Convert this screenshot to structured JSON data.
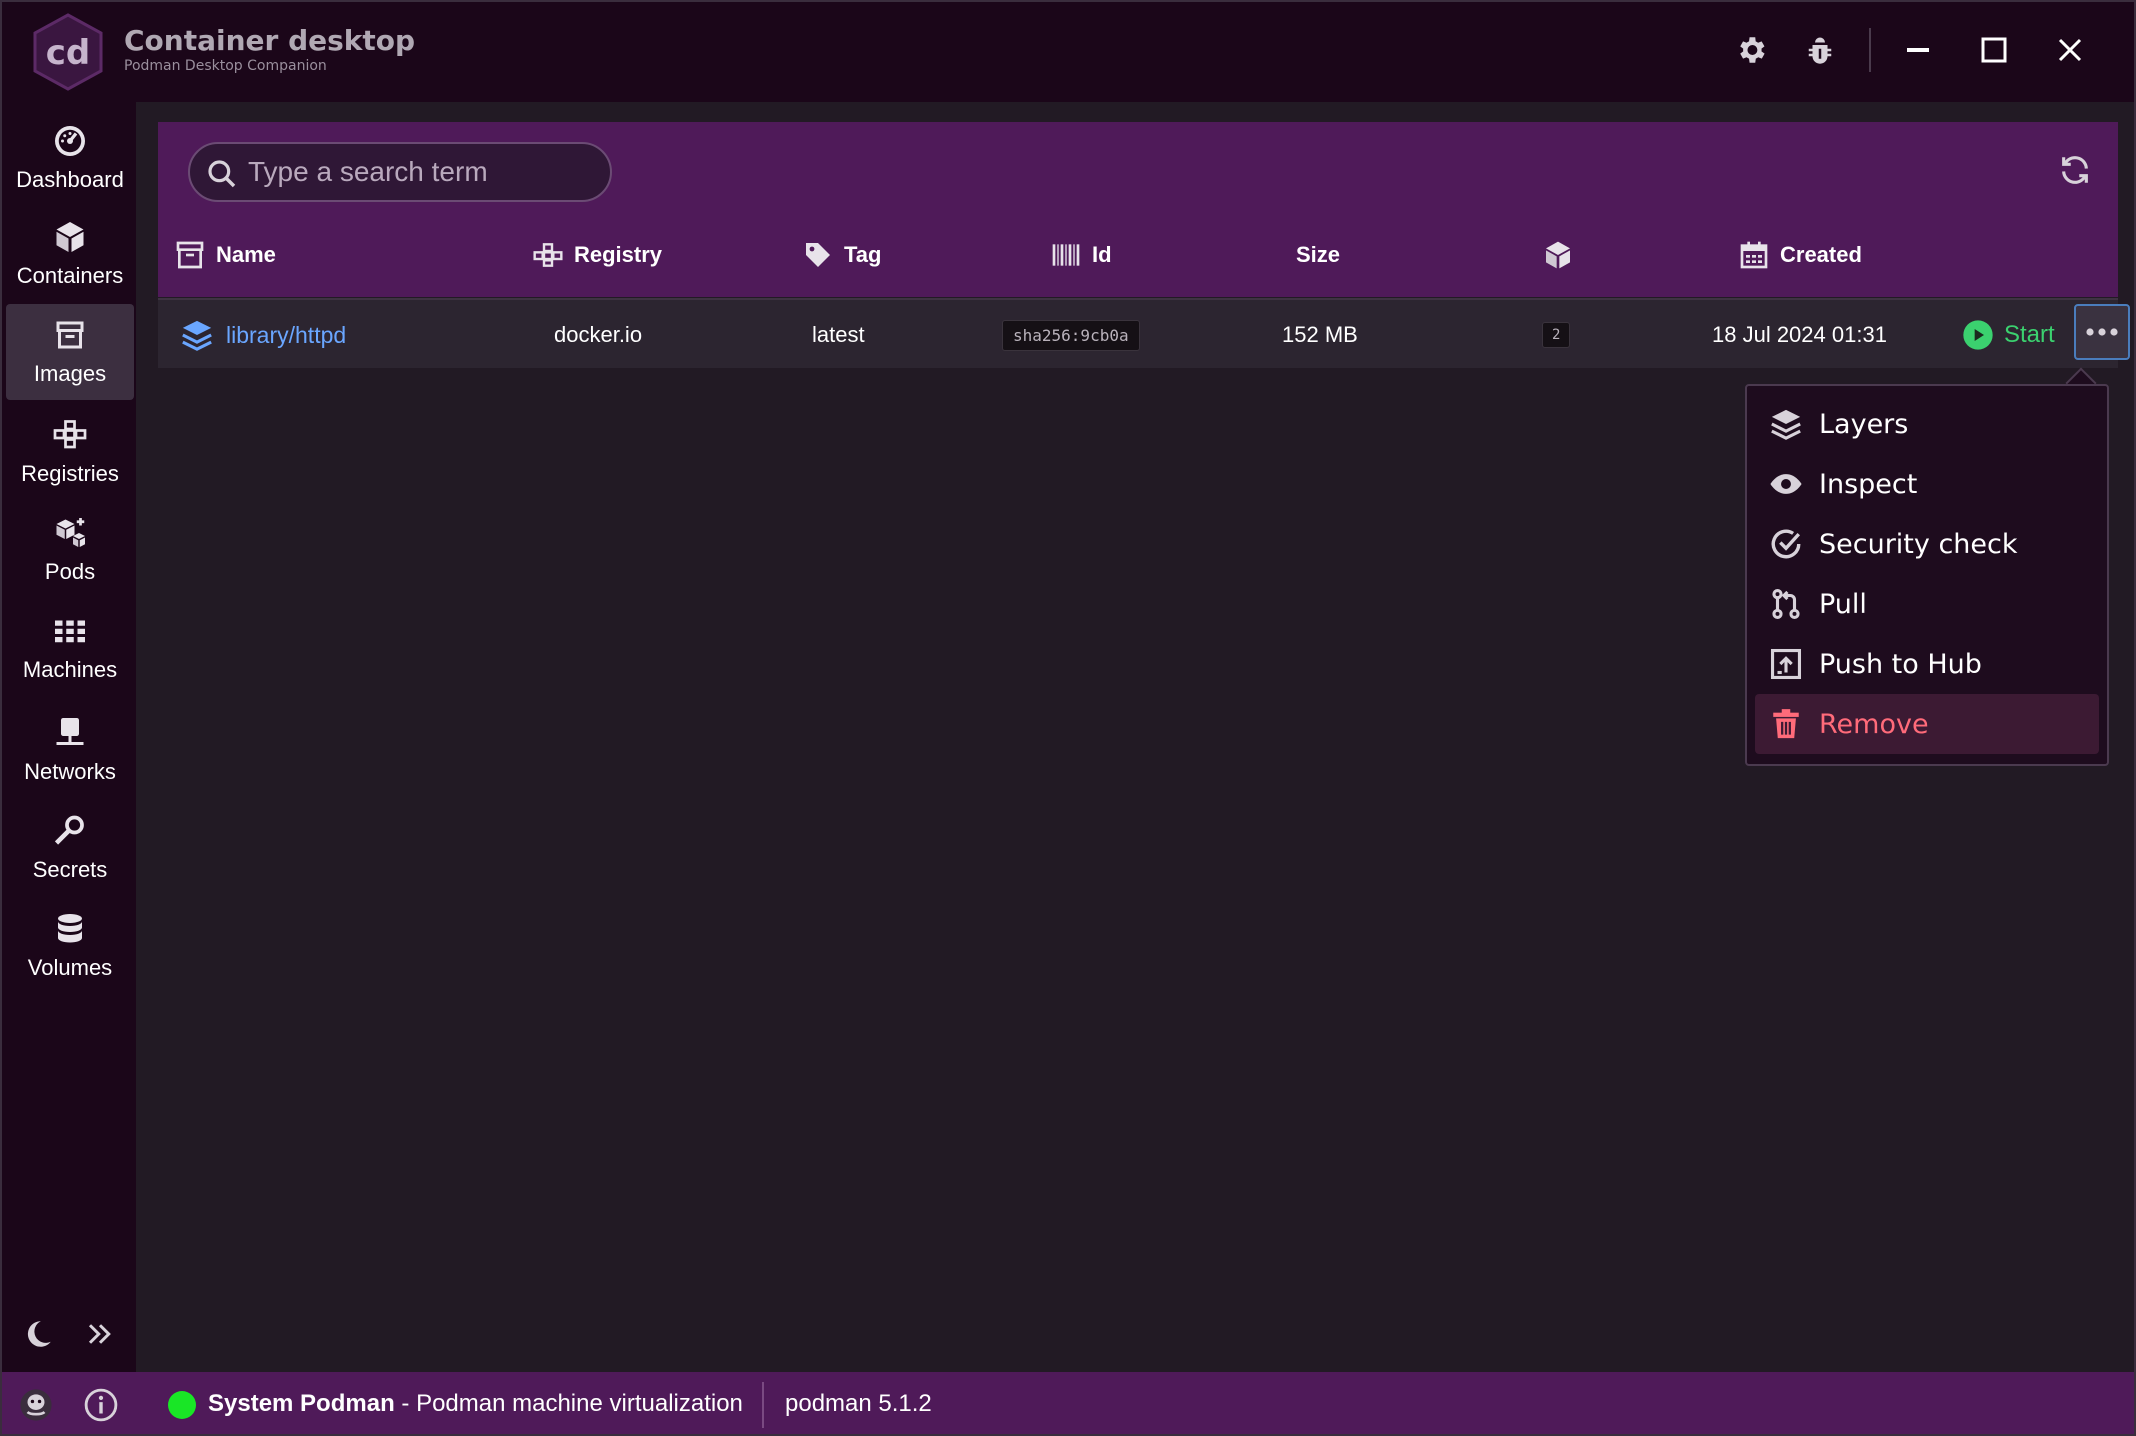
{
  "app": {
    "title": "Container desktop",
    "subtitle": "Podman Desktop Companion",
    "logo_text": "cd"
  },
  "sidebar": {
    "items": [
      {
        "label": "Dashboard",
        "icon": "gauge-icon"
      },
      {
        "label": "Containers",
        "icon": "cube-icon"
      },
      {
        "label": "Images",
        "icon": "box-icon",
        "active": true
      },
      {
        "label": "Registries",
        "icon": "registry-icon"
      },
      {
        "label": "Pods",
        "icon": "cubes-icon"
      },
      {
        "label": "Machines",
        "icon": "grid-icon"
      },
      {
        "label": "Networks",
        "icon": "network-icon"
      },
      {
        "label": "Secrets",
        "icon": "key-icon"
      },
      {
        "label": "Volumes",
        "icon": "database-icon"
      }
    ]
  },
  "search": {
    "placeholder": "Type a search term",
    "value": ""
  },
  "table": {
    "columns": [
      {
        "label": "Name",
        "icon": "box-icon"
      },
      {
        "label": "Registry",
        "icon": "registry-icon"
      },
      {
        "label": "Tag",
        "icon": "tag-icon"
      },
      {
        "label": "Id",
        "icon": "barcode-icon"
      },
      {
        "label": "Size",
        "icon": ""
      },
      {
        "label": "",
        "icon": "cube-icon"
      },
      {
        "label": "Created",
        "icon": "calendar-icon"
      }
    ],
    "rows": [
      {
        "name": "library/httpd",
        "registry": "docker.io",
        "tag": "latest",
        "id": "sha256:9cb0a",
        "size": "152 MB",
        "containers": "2",
        "created": "18 Jul 2024 01:31",
        "action": "Start"
      }
    ]
  },
  "context_menu": {
    "items": [
      {
        "label": "Layers",
        "icon": "layers-icon"
      },
      {
        "label": "Inspect",
        "icon": "eye-icon"
      },
      {
        "label": "Security check",
        "icon": "check-circle-icon"
      },
      {
        "label": "Pull",
        "icon": "git-pull-icon"
      },
      {
        "label": "Push to Hub",
        "icon": "upload-icon"
      },
      {
        "label": "Remove",
        "icon": "trash-icon",
        "danger": true
      }
    ]
  },
  "statusbar": {
    "engine": "System Podman",
    "engine_detail": " - Podman machine virtualization",
    "version": "podman 5.1.2",
    "status_color": "#19e626"
  },
  "colors": {
    "accent": "#4f1a59",
    "link": "#6aa6ff",
    "start": "#3bd16f",
    "danger": "#ff6b7a"
  }
}
